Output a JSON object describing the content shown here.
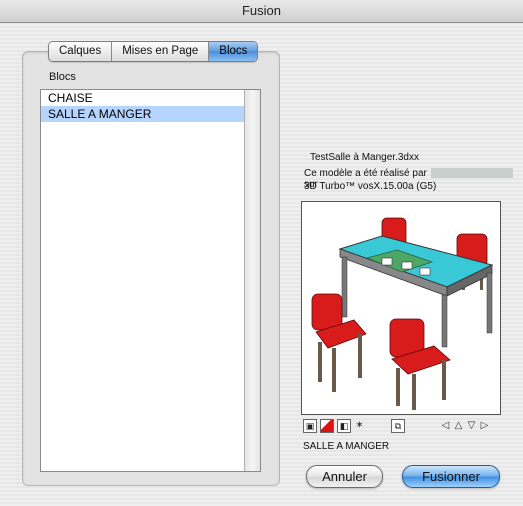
{
  "window": {
    "title": "Fusion"
  },
  "tabs": [
    {
      "label": "Calques",
      "active": false
    },
    {
      "label": "Mises en Page",
      "active": false
    },
    {
      "label": "Blocs",
      "active": true
    }
  ],
  "blocs": {
    "label": "Blocs",
    "items": [
      {
        "label": "CHAISE",
        "selected": false
      },
      {
        "label": "SALLE A MANGER",
        "selected": true
      }
    ]
  },
  "info": {
    "filename": "TestSalle à Manger.3dxx",
    "made_by_prefix": "Ce modèle a été réalisé par",
    "made_by_suffix": "sur",
    "software": "3D Turbo™ vosX.15.00a (G5)"
  },
  "preview": {
    "icons": [
      "cube-front-icon",
      "cube-red-icon",
      "cube-side-icon",
      "walk-icon",
      "cube-double-icon",
      "arrow-left-icon",
      "arrow-up-icon",
      "arrow-down-icon",
      "arrow-right-icon"
    ],
    "colors": {
      "chair_seat": "#d81b1b",
      "table_top": "#39c8d6",
      "legs": "#6b5a4a"
    }
  },
  "selected_block_name": "SALLE A MANGER",
  "buttons": {
    "cancel": "Annuler",
    "merge": "Fusionner"
  }
}
